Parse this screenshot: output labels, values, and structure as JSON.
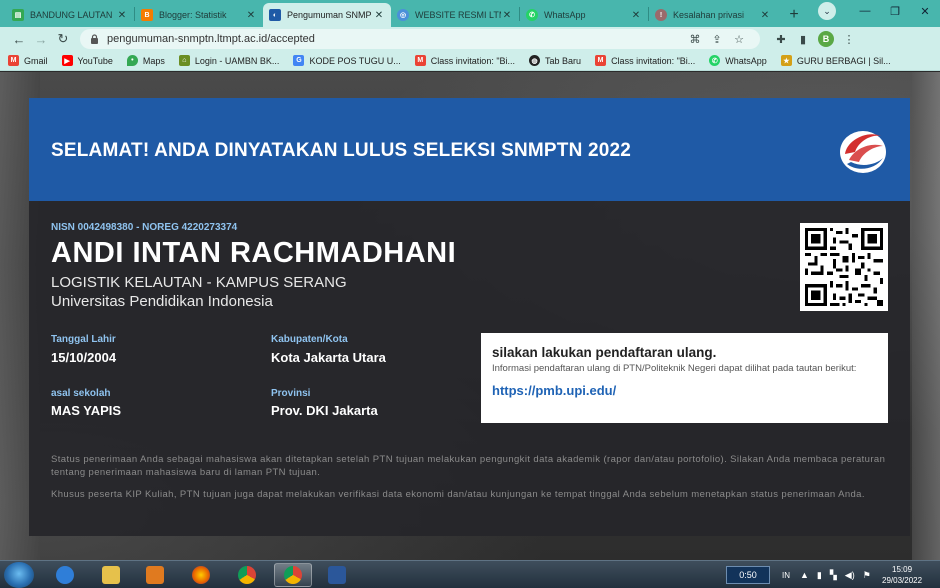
{
  "browser": {
    "tabs": [
      {
        "label": "BANDUNG LAUTAN",
        "icon": "green-sheet-icon",
        "color": "#34a853",
        "active": false
      },
      {
        "label": "Blogger: Statistik",
        "icon": "blogger-icon",
        "color": "#f57c00",
        "active": false
      },
      {
        "label": "Pengumuman SNMP",
        "icon": "snmptn-logo-icon",
        "color": "#1f5aa6",
        "active": true
      },
      {
        "label": "WEBSITE RESMI LTM",
        "icon": "globe-icon",
        "color": "#4a90d9",
        "active": false
      },
      {
        "label": "WhatsApp",
        "icon": "whatsapp-icon",
        "color": "#25d366",
        "active": false
      },
      {
        "label": "Kesalahan privasi",
        "icon": "warning-icon",
        "color": "#9a6b6b",
        "active": false
      }
    ],
    "url": "pengumuman-snmptn.ltmpt.ac.id/accepted",
    "profile_initial": "B",
    "bookmarks": [
      {
        "label": "Gmail",
        "color": "#ea4335",
        "glyph": "M"
      },
      {
        "label": "YouTube",
        "color": "#ff0000",
        "glyph": "▶"
      },
      {
        "label": "Maps",
        "color": "#34a853",
        "glyph": "•"
      },
      {
        "label": "Login - UAMBN BK...",
        "color": "#6b8e23",
        "glyph": "⌂"
      },
      {
        "label": "KODE POS TUGU U...",
        "color": "#4285f4",
        "glyph": "G"
      },
      {
        "label": "Class invitation: \"Bi...",
        "color": "#ea4335",
        "glyph": "M"
      },
      {
        "label": "Tab Baru",
        "color": "#222222",
        "glyph": "◍"
      },
      {
        "label": "Class invitation: \"Bi...",
        "color": "#ea4335",
        "glyph": "M"
      },
      {
        "label": "WhatsApp",
        "color": "#25d366",
        "glyph": "✆"
      },
      {
        "label": "GURU BERBAGI | Sil...",
        "color": "#d4a017",
        "glyph": "★"
      }
    ]
  },
  "announcement": {
    "headline": "SELAMAT! ANDA DINYATAKAN LULUS SELEKSI SNMPTN 2022",
    "ids": "NISN 0042498380 - NOREG 4220273374",
    "name": "ANDI INTAN RACHMADHANI",
    "program": "LOGISTIK KELAUTAN - KAMPUS SERANG",
    "university": "Universitas Pendidikan Indonesia",
    "fields": {
      "birth_label": "Tanggal Lahir",
      "birth_value": "15/10/2004",
      "regency_label": "Kabupaten/Kota",
      "regency_value": "Kota Jakarta Utara",
      "school_label": "asal sekolah",
      "school_value": "MAS YAPIS",
      "province_label": "Provinsi",
      "province_value": "Prov. DKI Jakarta"
    },
    "info_box": {
      "heading": "silakan lakukan pendaftaran ulang.",
      "subtext": "Informasi pendaftaran ulang di PTN/Politeknik Negeri dapat dilihat pada tautan berikut:",
      "link": "https://pmb.upi.edu/"
    },
    "note1": "Status penerimaan Anda sebagai mahasiswa akan ditetapkan setelah PTN tujuan melakukan pengungkit data akademik (rapor dan/atau portofolio). Silakan Anda membaca peraturan tentang penerimaan mahasiswa baru di laman PTN tujuan.",
    "note2": "Khusus peserta KIP Kuliah, PTN tujuan juga dapat melakukan verifikasi data ekonomi dan/atau kunjungan ke tempat tinggal Anda sebelum menetapkan status penerimaan Anda.",
    "accent_color": "#1f5aa6",
    "label_color": "#8fc3ef"
  },
  "taskbar": {
    "apps": [
      {
        "name": "internet-explorer-icon",
        "color": "#2f7ed8"
      },
      {
        "name": "file-explorer-icon",
        "color": "#e6c14b"
      },
      {
        "name": "media-player-icon",
        "color": "#e07a1f"
      },
      {
        "name": "firefox-icon",
        "color": "#e66000"
      },
      {
        "name": "chrome-icon",
        "color": "#4caf50"
      },
      {
        "name": "chrome-profile-icon",
        "color": "#4caf50"
      },
      {
        "name": "word-icon",
        "color": "#2b579a"
      }
    ],
    "video_time": "0:50",
    "language": "IN",
    "time": "15:09",
    "date": "29/03/2022"
  }
}
